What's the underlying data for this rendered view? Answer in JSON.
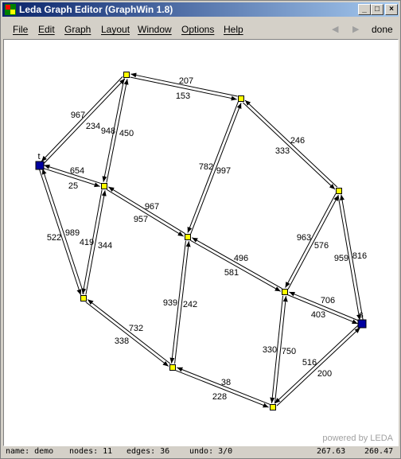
{
  "window": {
    "title": "Leda Graph Editor (GraphWin 1.8)"
  },
  "menu": {
    "items": [
      {
        "label": "File"
      },
      {
        "label": "Edit"
      },
      {
        "label": "Graph"
      },
      {
        "label": "Layout"
      },
      {
        "label": "Window"
      },
      {
        "label": "Options"
      },
      {
        "label": "Help"
      }
    ],
    "done_label": "done"
  },
  "graph": {
    "nodes": [
      {
        "id": "n1",
        "label": ""
      },
      {
        "id": "n2",
        "label": ""
      },
      {
        "id": "t",
        "label": "t"
      },
      {
        "id": "n4",
        "label": ""
      },
      {
        "id": "n5",
        "label": ""
      },
      {
        "id": "n6",
        "label": ""
      },
      {
        "id": "n7",
        "label": ""
      },
      {
        "id": "n8",
        "label": ""
      },
      {
        "id": "s",
        "label": "s"
      },
      {
        "id": "n10",
        "label": ""
      },
      {
        "id": "n11",
        "label": ""
      }
    ],
    "edge_labels": [
      "207",
      "153",
      "967",
      "234",
      "948",
      "450",
      "782",
      "997",
      "246",
      "333",
      "654",
      "25",
      "967",
      "957",
      "963",
      "576",
      "959",
      "816",
      "989",
      "522",
      "419",
      "344",
      "496",
      "581",
      "939",
      "242",
      "706",
      "403",
      "732",
      "338",
      "330",
      "750",
      "516",
      "200",
      "38",
      "228"
    ]
  },
  "watermark": "powered by LEDA",
  "status": {
    "name": "name: demo",
    "nodes": "nodes: 11",
    "edges": "edges: 36",
    "undo": "undo: 3/0",
    "x": "267.63",
    "y": "260.47"
  },
  "colors": {
    "node_fill": "#ffff00",
    "terminal_fill": "#0000a0",
    "title_start": "#0a246a",
    "title_end": "#a6caf0"
  }
}
